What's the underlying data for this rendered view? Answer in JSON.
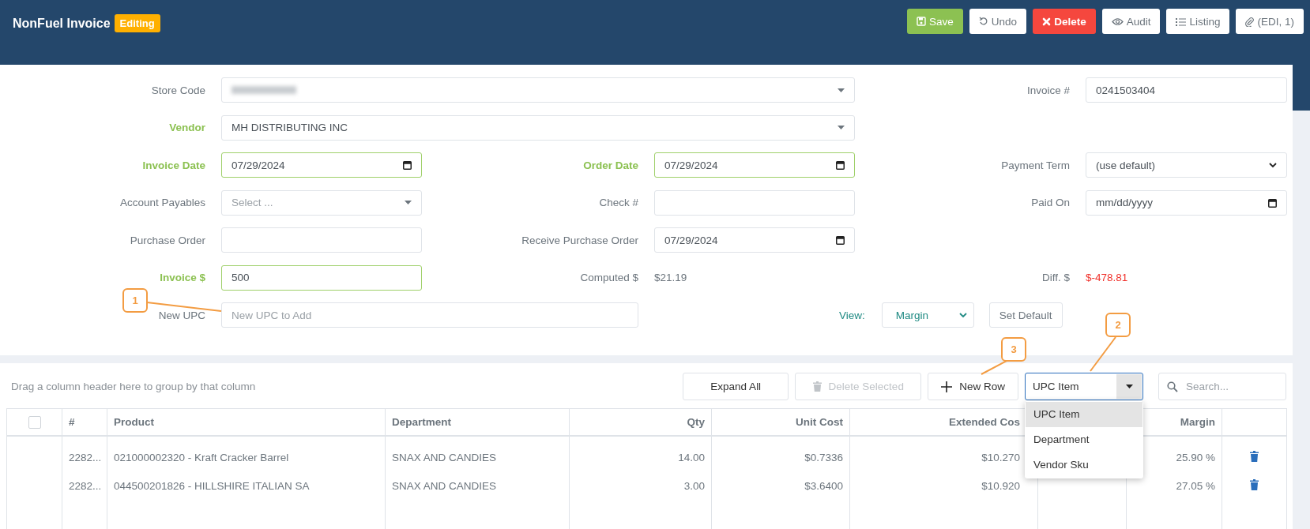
{
  "header": {
    "title": "NonFuel Invoice",
    "badge": "Editing",
    "buttons": [
      {
        "kind": "save",
        "label": "Save"
      },
      {
        "kind": "undo",
        "label": "Undo"
      },
      {
        "kind": "delete",
        "label": "Delete"
      },
      {
        "kind": "audit",
        "label": "Audit"
      },
      {
        "kind": "listing",
        "label": "Listing"
      },
      {
        "kind": "attachment",
        "label": "(EDI, 1)"
      }
    ]
  },
  "form": {
    "rows": [
      {
        "left": {
          "label": "Store Code",
          "kind": "dropdown",
          "required": false,
          "redacted": true
        },
        "right": {
          "label": "Invoice #",
          "kind": "text",
          "required": false,
          "value": "0241503404"
        }
      },
      {
        "left": {
          "label": "Vendor",
          "kind": "dropdown",
          "required": true,
          "value": "MH DISTRIBUTING INC"
        }
      },
      {
        "left": {
          "label": "Invoice Date",
          "kind": "date",
          "required": true,
          "value": "07/29/2024"
        },
        "middle": {
          "label": "Order Date",
          "kind": "date",
          "required": true,
          "value": "07/29/2024"
        },
        "right": {
          "label": "Payment Term",
          "kind": "select",
          "required": false,
          "value": "(use default)"
        }
      },
      {
        "left": {
          "label": "Account Payables",
          "kind": "dropdown",
          "required": false,
          "placeholder": "Select ..."
        },
        "middle": {
          "label": "Check #",
          "kind": "text",
          "required": false
        },
        "right": {
          "label": "Paid On",
          "kind": "date",
          "required": false,
          "placeholder": "mm/dd/yyyy"
        }
      },
      {
        "left": {
          "label": "Purchase Order",
          "kind": "text",
          "required": false
        },
        "middle": {
          "label": "Receive Purchase Order",
          "kind": "date",
          "required": false,
          "value": "07/29/2024"
        }
      },
      {
        "left": {
          "label": "Invoice $",
          "kind": "text",
          "required": true,
          "value": "500"
        },
        "middle": {
          "label": "Computed $",
          "kind": "readout",
          "alert": false,
          "value": "$21.19"
        },
        "right": {
          "label": "Diff. $",
          "kind": "readout",
          "alert": true,
          "value": "$-478.81"
        }
      },
      {
        "left": {
          "label": "New UPC",
          "kind": "text",
          "required": false,
          "placeholder": "New UPC to Add"
        },
        "view": {
          "label": "View:",
          "value": "Margin",
          "button": "Set Default"
        }
      }
    ]
  },
  "grid": {
    "hint": "Drag a column header here to group by that column",
    "buttons": [
      {
        "kind": "expand",
        "label": "Expand All",
        "disabled": false
      },
      {
        "kind": "delete",
        "label": "Delete Selected",
        "disabled": true
      },
      {
        "kind": "add",
        "label": "New Row",
        "disabled": false
      }
    ],
    "mode_select": {
      "value": "UPC Item",
      "expanded": true,
      "options": [
        {
          "label": "UPC Item",
          "selected": true
        },
        {
          "label": "Department",
          "selected": false
        },
        {
          "label": "Vendor Sku",
          "selected": false
        }
      ]
    },
    "search": {
      "placeholder": "Search..."
    },
    "select_all": {
      "checked": false
    },
    "columns": [
      {
        "header": "#"
      },
      {
        "header": "Product"
      },
      {
        "header": "Department"
      },
      {
        "header": "Qty"
      },
      {
        "header": "Unit Cost"
      },
      {
        "header": "Extended Cos"
      },
      {
        "header": "Margin"
      }
    ],
    "rows": [
      {
        "cells": [
          "2282...",
          "021000002320 - Kraft Cracker Barrel",
          "SNAX AND CANDIES",
          "14.00",
          "$0.7336",
          "$10.270",
          "25.90 %"
        ]
      },
      {
        "cells": [
          "2282...",
          "044500201826 - HILLSHIRE ITALIAN SA",
          "SNAX AND CANDIES",
          "3.00",
          "$3.6400",
          "$10.920",
          "27.05 %"
        ]
      }
    ]
  },
  "callouts": [
    {
      "label": "1"
    },
    {
      "label": "2"
    },
    {
      "label": "3"
    }
  ]
}
